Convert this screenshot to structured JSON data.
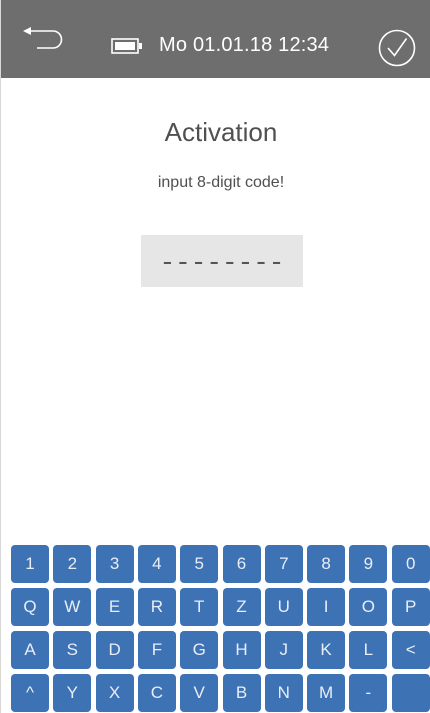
{
  "header": {
    "back_icon": "return-arrow-icon",
    "battery_icon": "battery-icon",
    "datetime": "Mo 01.01.18  12:34",
    "confirm_icon": "checkmark-circle-icon",
    "bar_color": "#6e6e6e"
  },
  "main": {
    "title": "Activation",
    "subtitle": "input 8-digit code!",
    "code_value": "--------"
  },
  "keyboard": {
    "key_color": "#3d72b5",
    "rows": [
      [
        "1",
        "2",
        "3",
        "4",
        "5",
        "6",
        "7",
        "8",
        "9",
        "0"
      ],
      [
        "Q",
        "W",
        "E",
        "R",
        "T",
        "Z",
        "U",
        "I",
        "O",
        "P"
      ],
      [
        "A",
        "S",
        "D",
        "F",
        "G",
        "H",
        "J",
        "K",
        "L",
        "<"
      ],
      [
        "^",
        "Y",
        "X",
        "C",
        "V",
        "B",
        "N",
        "M",
        "-",
        ""
      ]
    ]
  }
}
